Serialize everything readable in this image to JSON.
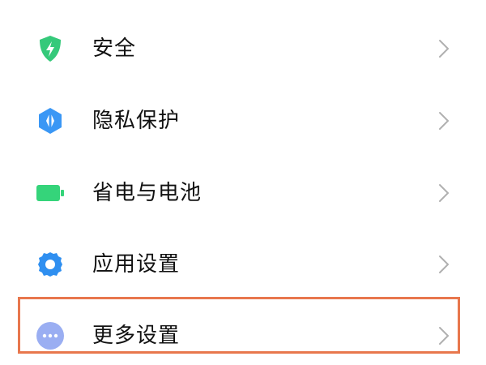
{
  "settings": {
    "items": [
      {
        "label": "安全",
        "icon": "shield-icon",
        "color": "#35c97a"
      },
      {
        "label": "隐私保护",
        "icon": "privacy-icon",
        "color": "#3a97f5"
      },
      {
        "label": "省电与电池",
        "icon": "battery-icon",
        "color": "#35d47a"
      },
      {
        "label": "应用设置",
        "icon": "gear-icon",
        "color": "#2f8ff0"
      },
      {
        "label": "更多设置",
        "icon": "more-icon",
        "color": "#9aaef2"
      }
    ],
    "highlight_color": "#e8774d"
  }
}
